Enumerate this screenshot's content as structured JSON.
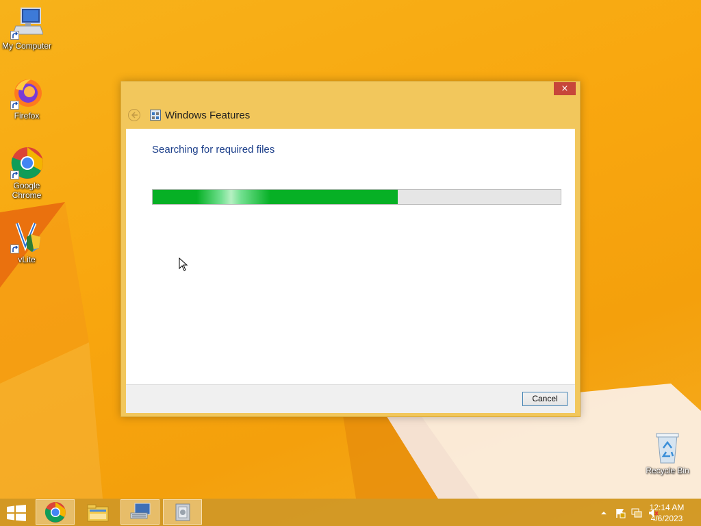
{
  "desktop": {
    "icons": [
      {
        "label": "My Computer"
      },
      {
        "label": "Firefox"
      },
      {
        "label": "Google Chrome"
      },
      {
        "label": "vLite"
      },
      {
        "label": "Recycle Bin"
      }
    ]
  },
  "dialog": {
    "title": "Windows Features",
    "close_label": "×",
    "status_text": "Searching for required files",
    "progress_fraction": 0.6,
    "cancel_label": "Cancel"
  },
  "taskbar": {
    "items": [
      {
        "name": "chrome-icon",
        "active": true
      },
      {
        "name": "file-explorer-icon",
        "active": false
      },
      {
        "name": "remote-desktop-icon",
        "active": true
      },
      {
        "name": "windows-features-icon",
        "active": true
      }
    ],
    "tray": {
      "time": "12:14 AM",
      "date": "4/6/2023"
    }
  },
  "colors": {
    "progress_green": "#06b025",
    "close_red": "#c7463a",
    "status_blue": "#1c3f8a",
    "desktop_orange": "#f9a70f"
  }
}
